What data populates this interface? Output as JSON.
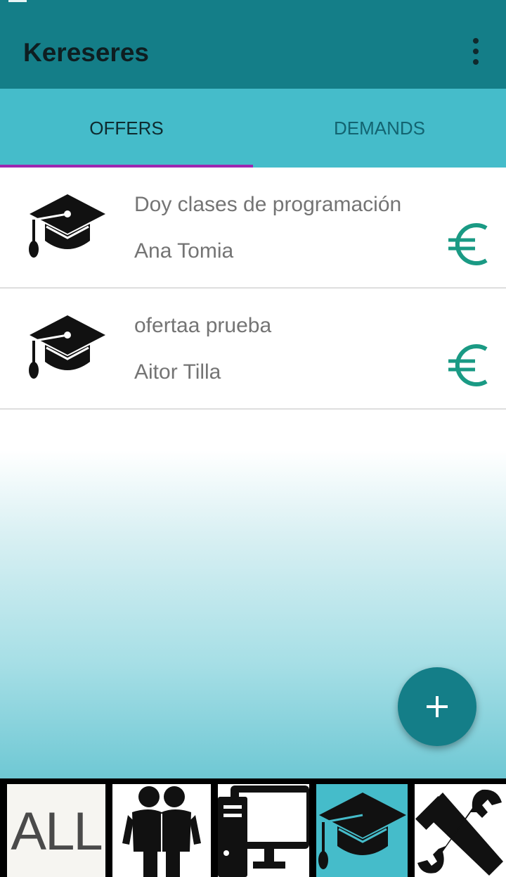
{
  "app": {
    "title": "Kereseres"
  },
  "tabs": [
    {
      "label": "OFFERS",
      "active": true
    },
    {
      "label": "DEMANDS",
      "active": false
    }
  ],
  "offers": [
    {
      "title": "Doy clases de programación",
      "owner": "Ana Tomia",
      "category_icon": "graduation-cap-icon",
      "price_icon": "euro-icon"
    },
    {
      "title": "ofertaa prueba",
      "owner": "Aitor Tilla",
      "category_icon": "graduation-cap-icon",
      "price_icon": "euro-icon"
    }
  ],
  "fab": {
    "icon": "plus-icon"
  },
  "categories": [
    {
      "label": "ALL",
      "icon": "all-text-icon",
      "selected": false
    },
    {
      "icon": "people-icon",
      "selected": false
    },
    {
      "icon": "computer-icon",
      "selected": false
    },
    {
      "icon": "graduation-cap-icon",
      "selected": true
    },
    {
      "icon": "tools-icon",
      "selected": false
    }
  ],
  "colors": {
    "primary": "#147e88",
    "tabs": "#45bcca",
    "indicator": "#9c27b0",
    "euro": "#1a9a84"
  }
}
